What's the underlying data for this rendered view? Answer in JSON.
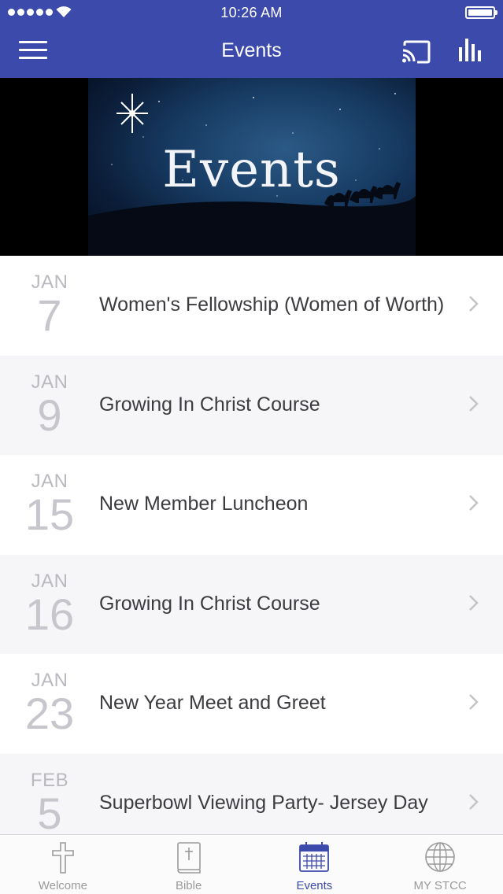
{
  "status_bar": {
    "time": "10:26 AM"
  },
  "header": {
    "title": "Events"
  },
  "banner": {
    "text": "Events"
  },
  "colors": {
    "primary": "#3c4bab",
    "date_text": "#b9b9c0",
    "chevron": "#c4c4c8",
    "tab_inactive": "#9a9a9a"
  },
  "icons": {
    "menu": "hamburger-icon",
    "cast": "cast-icon",
    "stats": "bar-chart-icon",
    "chevron": "chevron-right-icon"
  },
  "events": [
    {
      "month": "JAN",
      "day": "7",
      "title": "Women's Fellowship (Women of Worth)"
    },
    {
      "month": "JAN",
      "day": "9",
      "title": "Growing In Christ Course"
    },
    {
      "month": "JAN",
      "day": "15",
      "title": "New Member Luncheon"
    },
    {
      "month": "JAN",
      "day": "16",
      "title": "Growing In Christ Course"
    },
    {
      "month": "JAN",
      "day": "23",
      "title": "New Year Meet and Greet"
    },
    {
      "month": "FEB",
      "day": "5",
      "title": "Superbowl Viewing Party- Jersey Day"
    }
  ],
  "tabs": [
    {
      "label": "Welcome",
      "icon": "cross-icon",
      "active": false
    },
    {
      "label": "Bible",
      "icon": "bible-icon",
      "active": false
    },
    {
      "label": "Events",
      "icon": "calendar-icon",
      "active": true
    },
    {
      "label": "MY STCC",
      "icon": "globe-icon",
      "active": false
    }
  ]
}
